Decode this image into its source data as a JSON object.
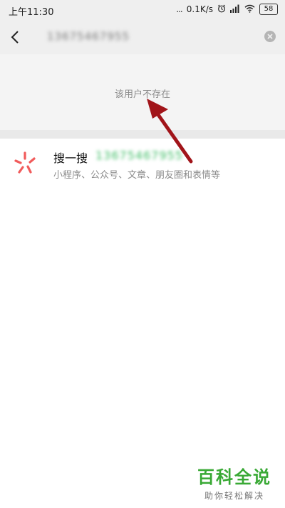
{
  "status_bar": {
    "time": "上午11:30",
    "dots": "...",
    "speed": "0.1K/s",
    "battery": "58"
  },
  "search": {
    "query": "13675467955"
  },
  "notice": {
    "text": "该用户不存在"
  },
  "result": {
    "title": "搜一搜",
    "query_highlight": "13675467955",
    "subtitle": "小程序、公众号、文章、朋友圈和表情等"
  },
  "watermark": {
    "main": "百科全说",
    "sub": "助你轻松解决"
  },
  "colors": {
    "accent_green": "#3fbd66",
    "arrow_red": "#a11419",
    "logo_red": "#f15b5b"
  }
}
